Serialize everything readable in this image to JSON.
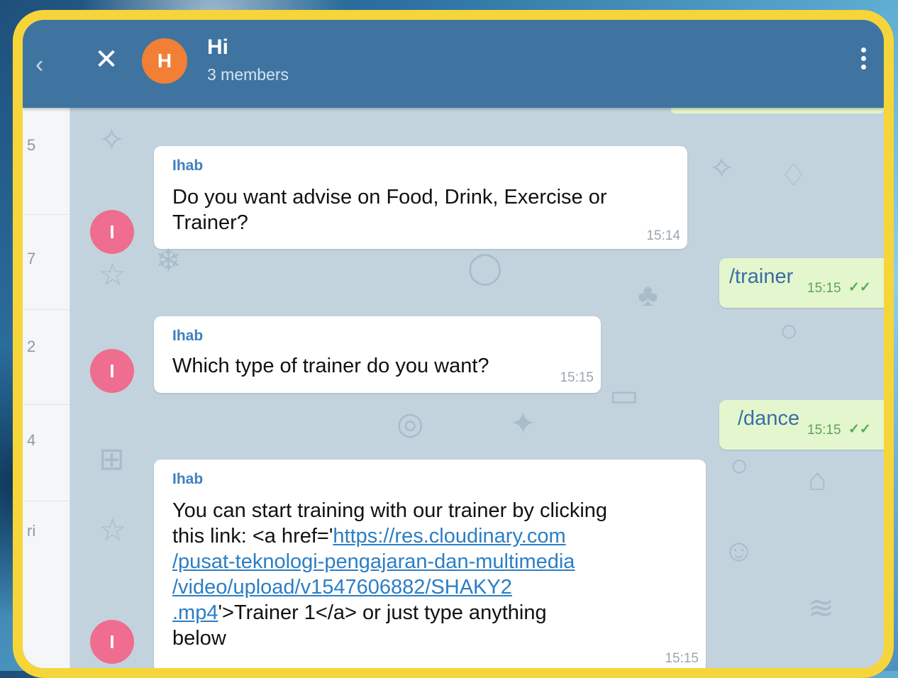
{
  "header": {
    "title": "Hi",
    "subtitle": "3 members",
    "avatar_letter": "H",
    "close_glyph": "✕",
    "back_glyph": "‹"
  },
  "sidebar": {
    "fragments": [
      "5",
      "7",
      "2",
      "4",
      "ri"
    ]
  },
  "messages": [
    {
      "direction": "in",
      "sender": "Ihab",
      "avatar_letter": "I",
      "text_lines": [
        "Do you want advise on Food, Drink, Exercise or",
        "Trainer?"
      ],
      "time": "15:14"
    },
    {
      "direction": "out",
      "text": "/trainer",
      "time": "15:15",
      "status": "read"
    },
    {
      "direction": "in",
      "sender": "Ihab",
      "avatar_letter": "I",
      "text": "Which type of trainer do you want?",
      "time": "15:15"
    },
    {
      "direction": "out",
      "text": "/dance",
      "time": "15:15",
      "status": "read"
    },
    {
      "direction": "in",
      "sender": "Ihab",
      "avatar_letter": "I",
      "line1": "You can start training with our trainer by clicking",
      "line2_prefix": "this link: <a href='",
      "link_parts": [
        "https://res.cloudinary.com",
        "/pusat-teknologi-pengajaran-dan-multimedia",
        "/video/upload/v1547606882/SHAKY2",
        ".mp4"
      ],
      "line5_suffix": "'>Trainer 1</a> or just type anything",
      "line6": "below",
      "time": "15:15"
    }
  ],
  "colors": {
    "header": "#3f74a1",
    "frame": "#f6d53b",
    "incoming": "#ffffff",
    "outgoing": "#e3f6cd",
    "sender": "#3f7fbf",
    "user_avatar": "#ef6d8f",
    "group_avatar": "#f17f36"
  }
}
